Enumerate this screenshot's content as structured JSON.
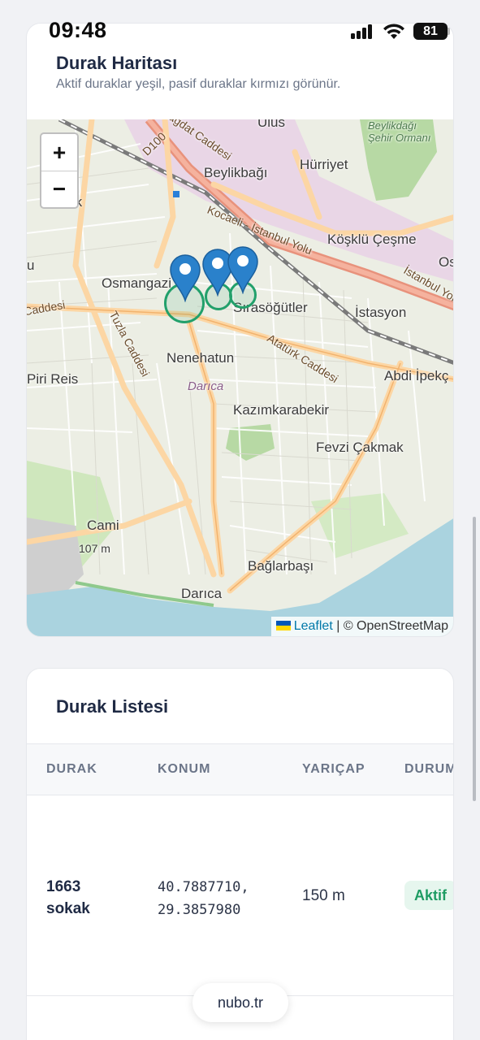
{
  "status_bar": {
    "time": "09:48",
    "battery": "81"
  },
  "map_section": {
    "title": "Durak Haritası",
    "subtitle": "Aktif duraklar yeşil, pasif duraklar kırmızı görünür.",
    "zoom_in": "+",
    "zoom_out": "−",
    "attribution": {
      "leaflet": "Leaflet",
      "sep": " | © OpenStreetMap"
    },
    "labels": {
      "ulus": "Ulus",
      "beylikdagi_forest": "Beylikdağı Şehir Ormanı",
      "beylikbagi": "Beylikbağı",
      "hurriyet": "Hürriyet",
      "d100": "D100",
      "bagdat": "Bağdat Caddesi",
      "kocaeli": "Kocaeli - İstanbul Yolu",
      "mek": "mek",
      "kosklu": "Köşklü Çeşme",
      "os": "Os",
      "osmangazi": "Osmangazi",
      "sirasogutler": "Sırasöğütler",
      "istasyon": "İstasyon",
      "istanbul_yolu": "İstanbul Yolu",
      "caddesi_left": "Caddesi",
      "tuzla": "Tuzla Caddesi",
      "ataturk": "Atatürk Caddesi",
      "nenehatun": "Nenehatun",
      "piri_reis": "Piri Reis",
      "abdi_ipekci": "Abdi İpekç",
      "darica_city": "Darıca",
      "kazimkarabekir": "Kazımkarabekir",
      "fevzi_cakmak": "Fevzi Çakmak",
      "cami": "Cami",
      "elev": "107 m",
      "baglarbasi": "Bağlarbaşı",
      "darica": "Darıca",
      "u": "u"
    }
  },
  "list_section": {
    "title": "Durak Listesi",
    "columns": [
      "DURAK",
      "KONUM",
      "YARIÇAP",
      "DURUM"
    ],
    "rows": [
      {
        "name": "1663 sokak",
        "location": "40.7887710,\n29.3857980",
        "radius": "150 m",
        "status": "Aktif"
      }
    ]
  },
  "footer": {
    "domain": "nubo.tr"
  },
  "colors": {
    "active": "#22a06b",
    "pin": "#2a81cb",
    "text": "#1f2a44"
  }
}
